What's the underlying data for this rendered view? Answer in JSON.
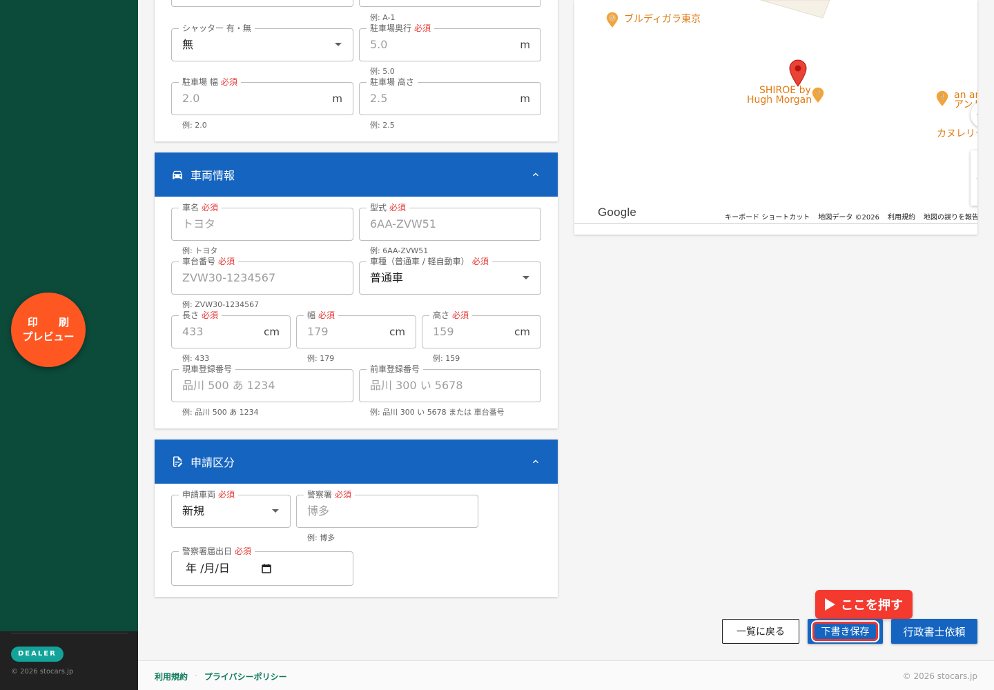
{
  "sidebar": {
    "badge": "DEALER",
    "copyright": "© 2026 stocars.jp"
  },
  "print_fab": {
    "line1": "印刷",
    "line2": "プレビュー"
  },
  "parking": {
    "partial_hint": "例: A-1",
    "shutter": {
      "label": "シャッター 有・無",
      "value": "無"
    },
    "depth": {
      "label": "駐車場奥行",
      "required": "必須",
      "placeholder": "5.0",
      "unit": "m",
      "hint": "例: 5.0"
    },
    "width": {
      "label": "駐車場 幅",
      "required": "必須",
      "placeholder": "2.0",
      "unit": "m",
      "hint": "例: 2.0"
    },
    "height": {
      "label": "駐車場 高さ",
      "placeholder": "2.5",
      "unit": "m",
      "hint": "例: 2.5"
    }
  },
  "vehicle": {
    "title": "車両情報",
    "name": {
      "label": "車名",
      "required": "必須",
      "placeholder": "トヨタ",
      "hint": "例: トヨタ"
    },
    "model": {
      "label": "型式",
      "required": "必須",
      "placeholder": "6AA-ZVW51",
      "hint": "例: 6AA-ZVW51"
    },
    "chassis": {
      "label": "車台番号",
      "required": "必須",
      "placeholder": "ZVW30-1234567",
      "hint": "例: ZVW30-1234567"
    },
    "kind": {
      "label": "車種（普通車 / 軽自動車）",
      "required": "必須",
      "value": "普通車"
    },
    "length": {
      "label": "長さ",
      "required": "必須",
      "placeholder": "433",
      "unit": "cm",
      "hint": "例: 433"
    },
    "w": {
      "label": "幅",
      "required": "必須",
      "placeholder": "179",
      "unit": "cm",
      "hint": "例: 179"
    },
    "h": {
      "label": "高さ",
      "required": "必須",
      "placeholder": "159",
      "unit": "cm",
      "hint": "例: 159"
    },
    "current_reg": {
      "label": "現車登録番号",
      "placeholder": "品川 500 あ 1234",
      "hint": "例: 品川 500 あ 1234"
    },
    "prev_reg": {
      "label": "前車登録番号",
      "placeholder": "品川 300 い 5678",
      "hint": "例: 品川 300 い 5678 または 車台番号"
    }
  },
  "application": {
    "title": "申請区分",
    "vehicle_type": {
      "label": "申請車両",
      "required": "必須",
      "value": "新規"
    },
    "police": {
      "label": "警察署",
      "required": "必須",
      "placeholder": "博多",
      "hint": "例: 博多"
    },
    "date": {
      "label": "警察署届出日",
      "required": "必須",
      "value": "年 /月/日"
    }
  },
  "map": {
    "labels": {
      "bruditta": "ブルディガラ東京",
      "shiroe1": "SHIROE by",
      "shiroe2": "Hugh Morgan",
      "anand1": "an and an",
      "anand2": "アンドアン",
      "canaletto": "カヌレリテ ク"
    },
    "google": "Google",
    "bar": [
      "キーボード ショートカット",
      "地図データ ©2026",
      "利用規約",
      "地図の誤りを報告する"
    ]
  },
  "buttons": {
    "back": "一覧に戻る",
    "save": "下書き保存",
    "request": "行政書士依頼",
    "callout": "ここを押す"
  },
  "footer": {
    "terms": "利用規約",
    "privacy": "プライバシーポリシー",
    "copyright": "© 2026 stocars.jp"
  },
  "colors": {
    "sidebar": "#0c4a3a",
    "header": "#1565c0",
    "fab": "#ff5722",
    "required": "#e53935",
    "callout": "#f4392f"
  }
}
